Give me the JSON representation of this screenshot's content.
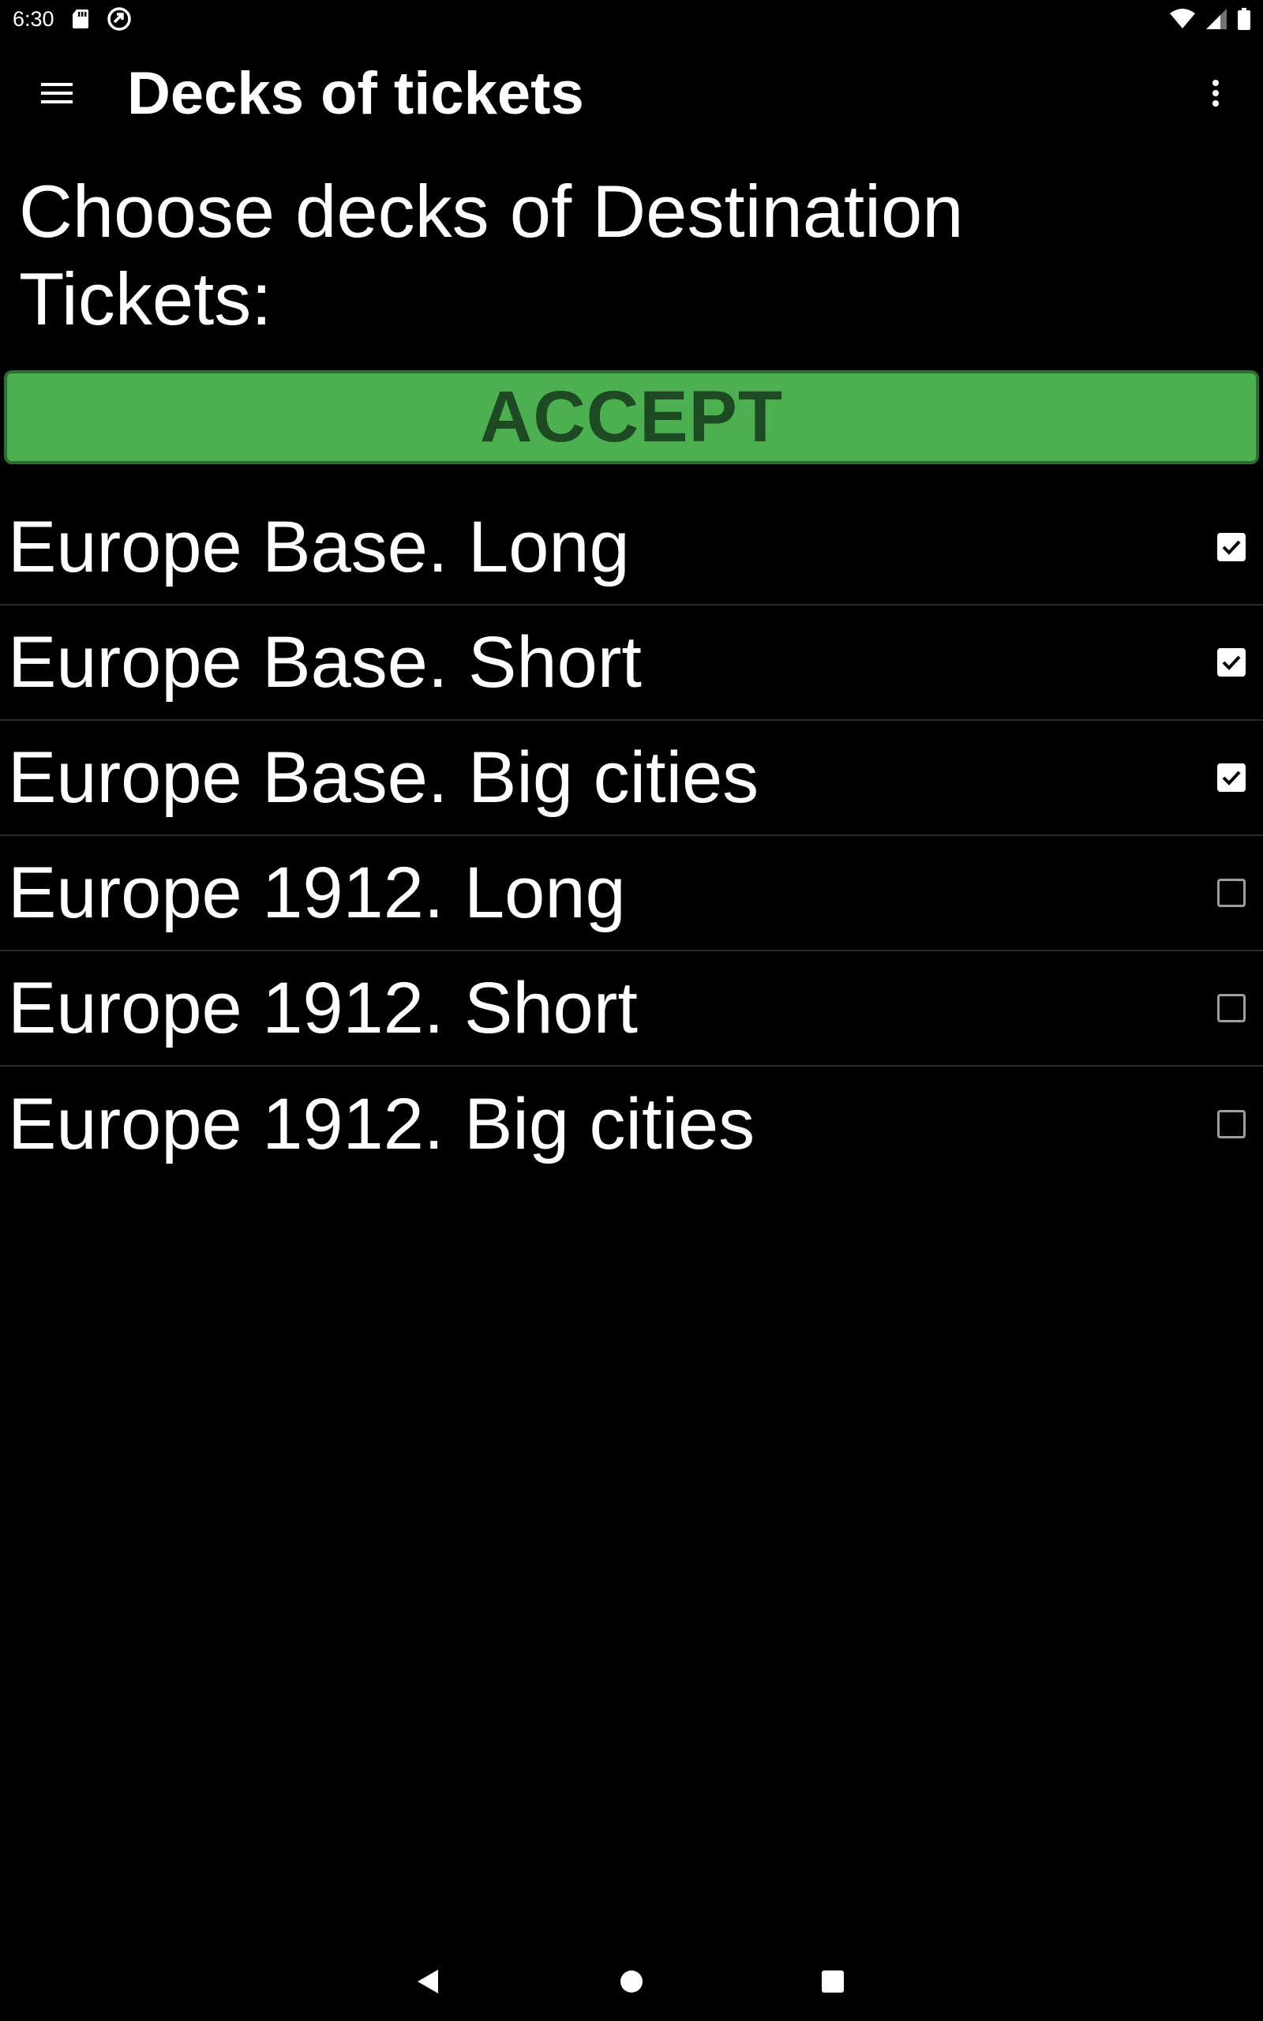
{
  "status_bar": {
    "time": "6:30",
    "icons": [
      "sd-card-icon",
      "sync-icon",
      "wifi-icon",
      "signal-icon",
      "battery-icon"
    ]
  },
  "app_bar": {
    "title": "Decks of tickets",
    "menu_icon": "hamburger-menu-icon",
    "overflow_icon": "more-vertical-icon"
  },
  "heading": "Choose decks of Destination Tickets:",
  "accept_label": "ACCEPT",
  "colors": {
    "accept_bg": "#4caf50",
    "accept_text": "#1d4a22",
    "background": "#000000",
    "text": "#ffffff"
  },
  "decks": [
    {
      "label": "Europe Base. Long",
      "checked": true
    },
    {
      "label": "Europe Base. Short",
      "checked": true
    },
    {
      "label": "Europe Base. Big cities",
      "checked": true
    },
    {
      "label": "Europe 1912. Long",
      "checked": false
    },
    {
      "label": "Europe 1912. Short",
      "checked": false
    },
    {
      "label": "Europe 1912. Big cities",
      "checked": false
    }
  ],
  "nav_bar": {
    "icons": [
      "back-icon",
      "home-icon",
      "recents-icon"
    ]
  }
}
